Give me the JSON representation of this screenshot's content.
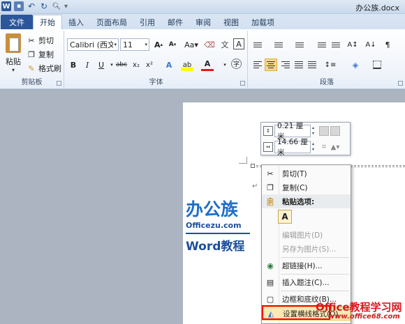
{
  "window": {
    "title": "办公族.docx"
  },
  "tabs": [
    "文件",
    "开始",
    "插入",
    "页面布局",
    "引用",
    "邮件",
    "审阅",
    "视图",
    "加载项"
  ],
  "clipboard": {
    "paste": "粘贴",
    "cut": "剪切",
    "copy": "复制",
    "format_painter": "格式刷",
    "group": "剪贴板"
  },
  "font": {
    "name": "Calibri (西文正",
    "size": "11",
    "group": "字体"
  },
  "paragraph": {
    "group": "段落"
  },
  "mini_toolbar": {
    "height": "0.21 厘米",
    "width": "14.66 厘米"
  },
  "context_menu": {
    "cut": "剪切(T)",
    "copy": "复制(C)",
    "paste_options": "粘贴选项:",
    "paste_icon": "A",
    "edit_picture": "编辑图片(D)",
    "save_as_picture": "另存为图片(S)...",
    "hyperlink": "超链接(H)...",
    "insert_caption": "插入题注(C)...",
    "borders": "边框和底纹(B)...",
    "format_hr": "设置横线格式(O)..."
  },
  "logo": {
    "cn": "办公族",
    "site": "Officezu.com",
    "tutorial": "Word教程"
  },
  "watermark": {
    "title": "Office教程学习网",
    "url": "www.office68.com"
  }
}
